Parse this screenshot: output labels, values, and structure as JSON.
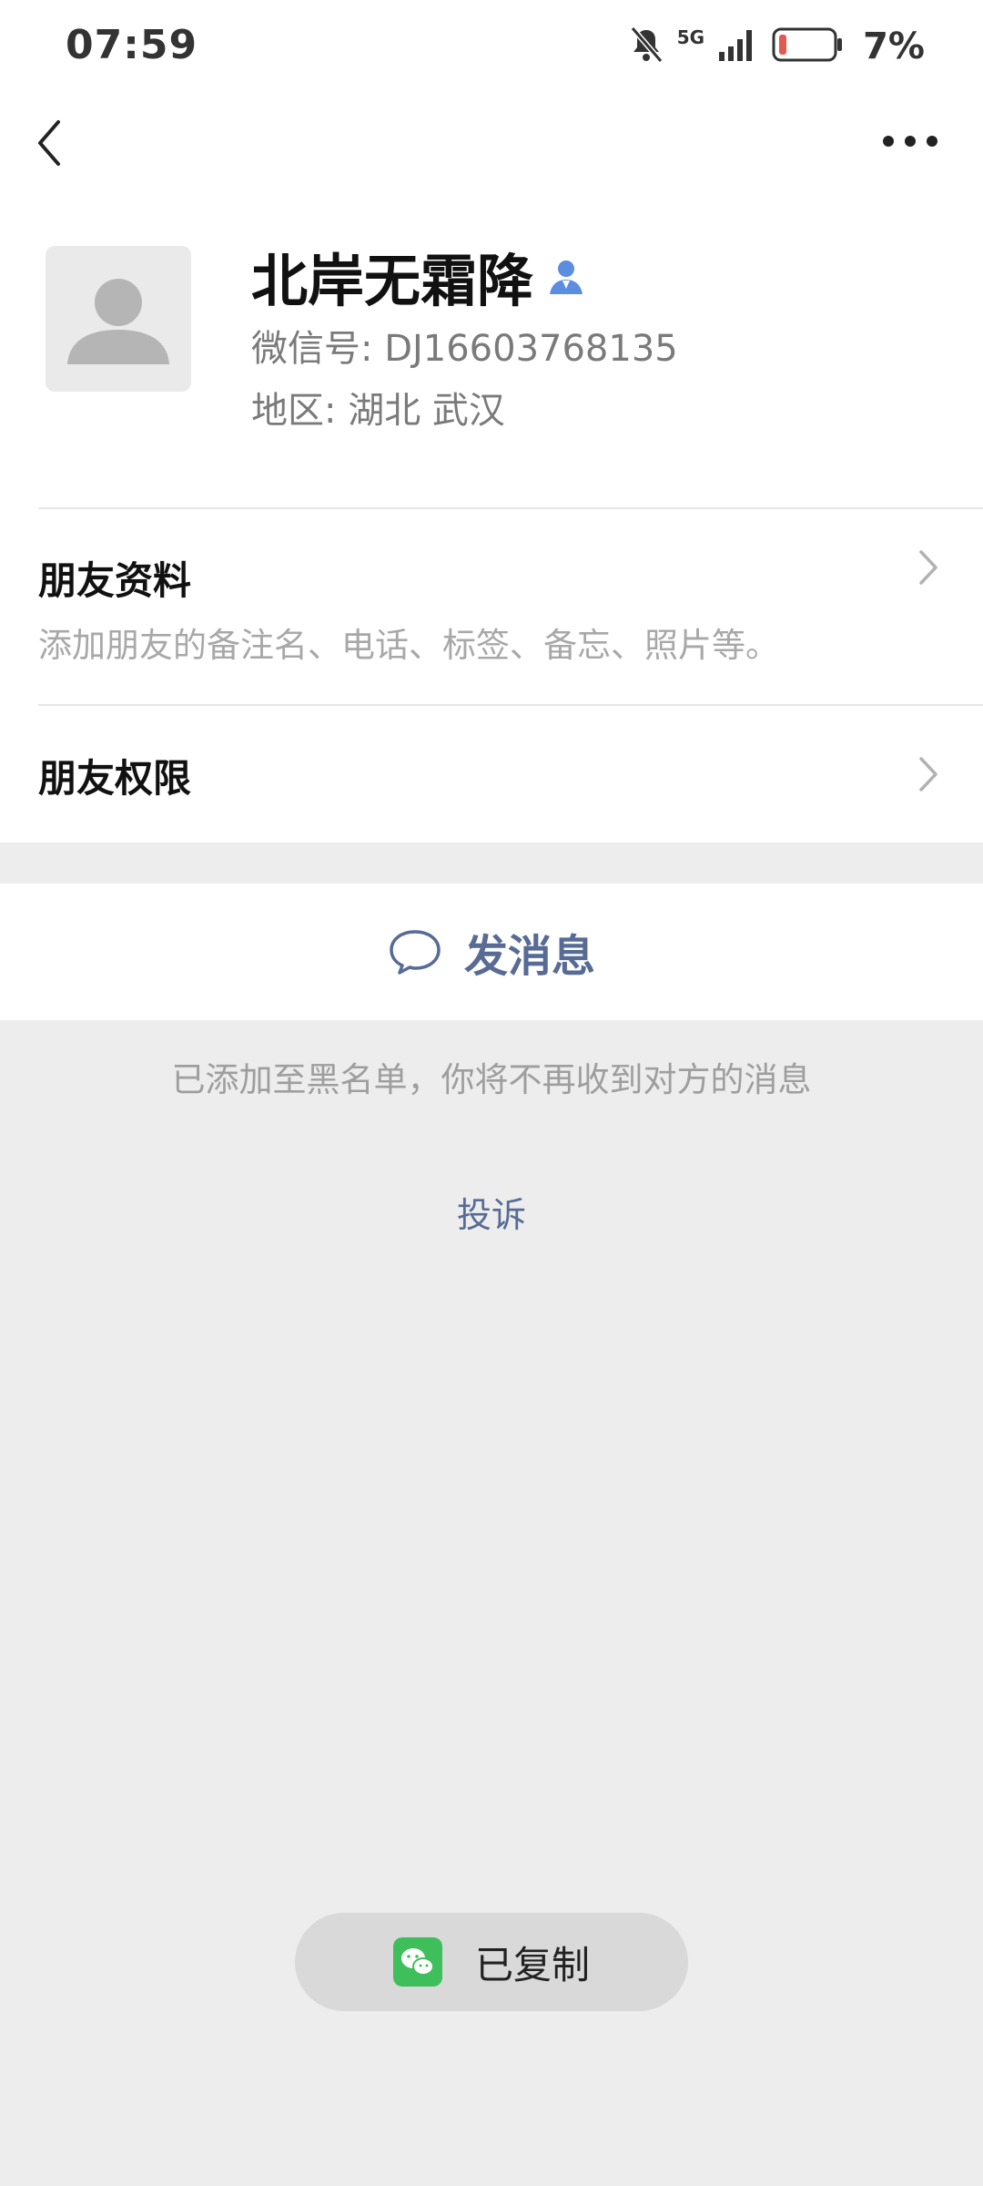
{
  "status_bar": {
    "time": "07:59",
    "network": "5G",
    "battery": "7%",
    "icons": [
      "bell-muted-icon",
      "signal-icon",
      "battery-icon"
    ]
  },
  "header": {
    "icons": [
      "back-arrow-icon",
      "more-dots-icon"
    ]
  },
  "profile": {
    "name": "北岸无霜降",
    "wechat_id": "微信号: DJ16603768135",
    "region": "地区: 湖北  武汉",
    "icons": [
      "avatar-placeholder-icon",
      "contact-person-icon"
    ]
  },
  "rows": {
    "friend_info_title": "朋友资料",
    "friend_info_subtitle": "添加朋友的备注名、电话、标签、备忘、照片等。",
    "friend_permissions_title": "朋友权限"
  },
  "actions": {
    "send_message": "发消息"
  },
  "notices": {
    "blacklist": "已添加至黑名单，你将不再收到对方的消息",
    "complain": "投诉"
  },
  "toast": {
    "label": "已复制"
  },
  "colors": {
    "link_blue": "#576b95",
    "background_gray": "#ededed",
    "battery_low": "#e05a4f",
    "wechat_green": "#3fbf5b"
  }
}
